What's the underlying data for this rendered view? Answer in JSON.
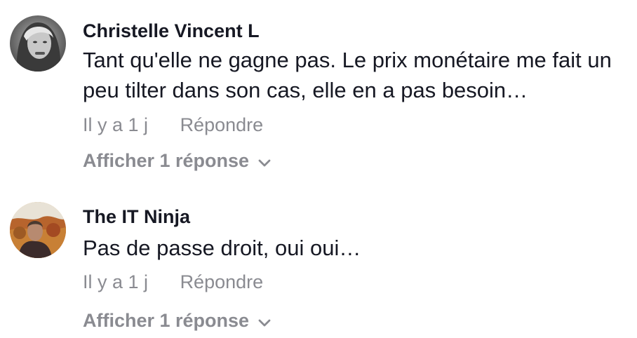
{
  "comments": [
    {
      "username": "Christelle Vincent L",
      "text": "Tant qu'elle ne gagne pas. Le prix monétaire me fait un peu tilter dans son cas, elle en a pas besoin…",
      "time": "Il y a 1 j",
      "reply_label": "Répondre",
      "view_replies_label": "Afficher 1 réponse",
      "avatar_icon": "user-avatar-photo"
    },
    {
      "username": "The IT Ninja",
      "text": "Pas de passe droit, oui oui…",
      "time": "Il y a 1 j",
      "reply_label": "Répondre",
      "view_replies_label": "Afficher 1 réponse",
      "avatar_icon": "user-avatar-photo"
    }
  ],
  "colors": {
    "primary_text": "#161823",
    "secondary_text": "#8a8b91",
    "background": "#ffffff"
  },
  "icons": {
    "expand": "chevron-down-icon"
  }
}
